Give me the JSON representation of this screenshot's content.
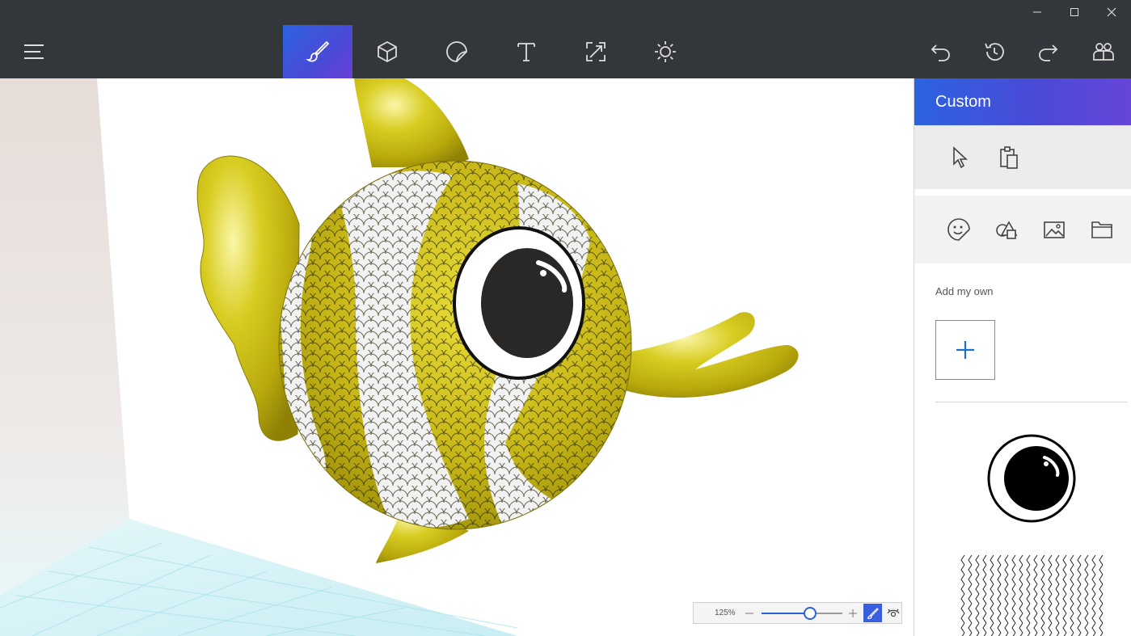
{
  "toolbar": {
    "menu_icon": "hamburger-menu-icon",
    "tools": [
      {
        "name": "brushes-icon",
        "active": true
      },
      {
        "name": "3d-shapes-icon",
        "active": false
      },
      {
        "name": "stickers-icon",
        "active": false
      },
      {
        "name": "text-icon",
        "active": false
      },
      {
        "name": "canvas-icon",
        "active": false
      },
      {
        "name": "effects-icon",
        "active": false
      }
    ],
    "right_tools": [
      "undo-icon",
      "history-icon",
      "redo-icon",
      "remix3d-icon"
    ],
    "accent_color": "#3b5be0"
  },
  "panel": {
    "title": "Custom",
    "add_my_own_label": "Add my own",
    "add_icon": "plus-icon",
    "row1_icons": [
      "select-pointer-icon",
      "paste-icon"
    ],
    "row2_icons": [
      "stickers-face-icon",
      "shapes-icon",
      "image-icon",
      "folder-icon"
    ],
    "items": [
      "eye-sticker",
      "scales-texture"
    ]
  },
  "zoom": {
    "value": "125%",
    "level": 0.6
  }
}
